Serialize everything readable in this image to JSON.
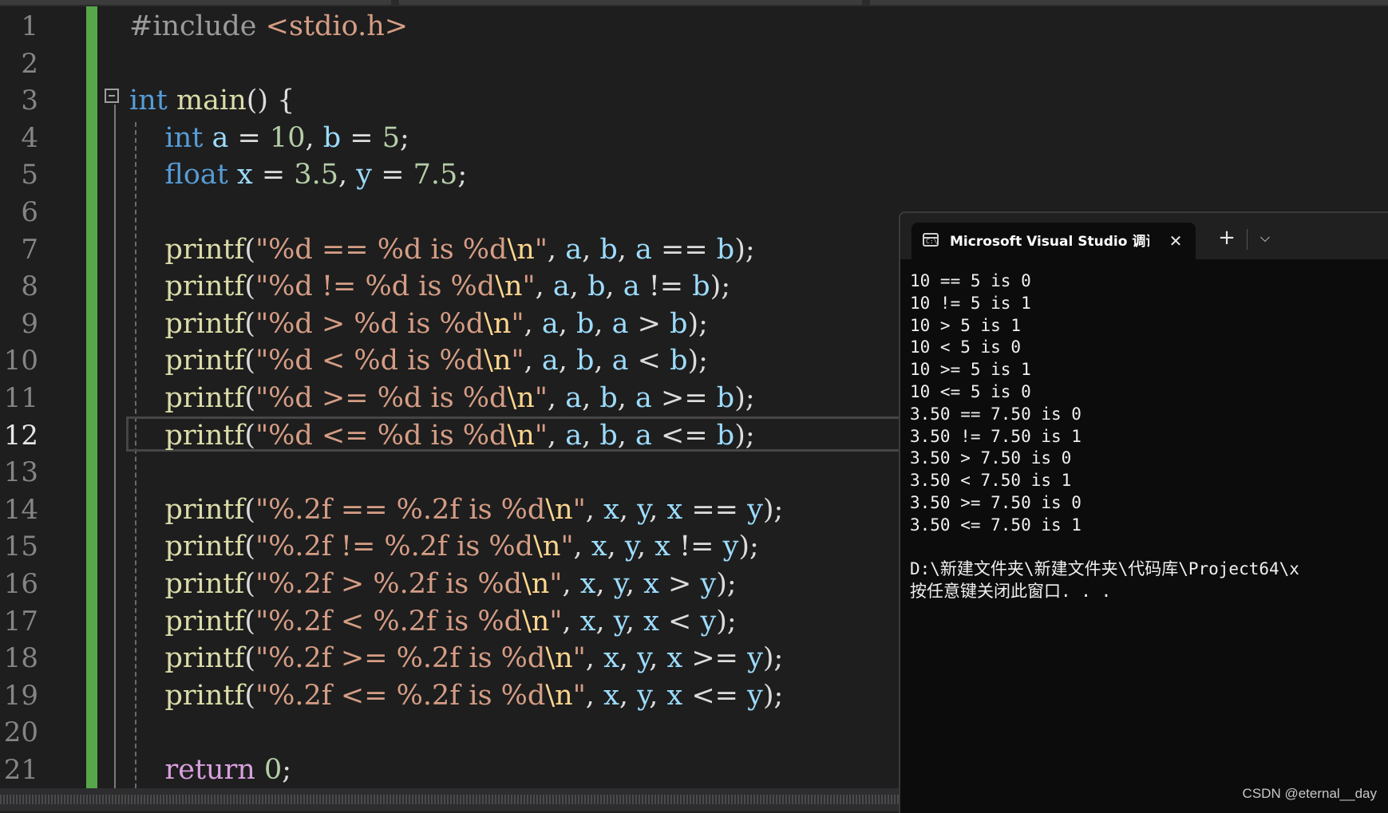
{
  "editor": {
    "line_numbers": [
      "1",
      "2",
      "3",
      "4",
      "5",
      "6",
      "7",
      "8",
      "9",
      "10",
      "11",
      "12",
      "13",
      "14",
      "15",
      "16",
      "17",
      "18",
      "19",
      "20",
      "21"
    ],
    "active_line": "12",
    "lines": [
      {
        "tokens": [
          {
            "t": "#include ",
            "c": "pp"
          },
          {
            "t": "<stdio.h>",
            "c": "str"
          }
        ]
      },
      {
        "tokens": []
      },
      {
        "tokens": [
          {
            "t": "int",
            "c": "kw"
          },
          {
            "t": " ",
            "c": ""
          },
          {
            "t": "main",
            "c": "fn"
          },
          {
            "t": "() {",
            "c": ""
          }
        ]
      },
      {
        "tokens": [
          {
            "t": "    ",
            "c": ""
          },
          {
            "t": "int",
            "c": "kw"
          },
          {
            "t": " ",
            "c": ""
          },
          {
            "t": "a",
            "c": "id"
          },
          {
            "t": " = ",
            "c": ""
          },
          {
            "t": "10",
            "c": "num"
          },
          {
            "t": ", ",
            "c": ""
          },
          {
            "t": "b",
            "c": "id"
          },
          {
            "t": " = ",
            "c": ""
          },
          {
            "t": "5",
            "c": "num"
          },
          {
            "t": ";",
            "c": ""
          }
        ]
      },
      {
        "tokens": [
          {
            "t": "    ",
            "c": ""
          },
          {
            "t": "float",
            "c": "kw"
          },
          {
            "t": " ",
            "c": ""
          },
          {
            "t": "x",
            "c": "id"
          },
          {
            "t": " = ",
            "c": ""
          },
          {
            "t": "3.5",
            "c": "num"
          },
          {
            "t": ", ",
            "c": ""
          },
          {
            "t": "y",
            "c": "id"
          },
          {
            "t": " = ",
            "c": ""
          },
          {
            "t": "7.5",
            "c": "num"
          },
          {
            "t": ";",
            "c": ""
          }
        ]
      },
      {
        "tokens": []
      },
      {
        "tokens": [
          {
            "t": "    ",
            "c": ""
          },
          {
            "t": "printf",
            "c": "fn"
          },
          {
            "t": "(",
            "c": ""
          },
          {
            "t": "\"%d == %d is %d",
            "c": "str"
          },
          {
            "t": "\\n",
            "c": "esc"
          },
          {
            "t": "\"",
            "c": "str"
          },
          {
            "t": ", ",
            "c": ""
          },
          {
            "t": "a",
            "c": "id"
          },
          {
            "t": ", ",
            "c": ""
          },
          {
            "t": "b",
            "c": "id"
          },
          {
            "t": ", ",
            "c": ""
          },
          {
            "t": "a",
            "c": "id"
          },
          {
            "t": " == ",
            "c": ""
          },
          {
            "t": "b",
            "c": "id"
          },
          {
            "t": ");",
            "c": ""
          }
        ]
      },
      {
        "tokens": [
          {
            "t": "    ",
            "c": ""
          },
          {
            "t": "printf",
            "c": "fn"
          },
          {
            "t": "(",
            "c": ""
          },
          {
            "t": "\"%d != %d is %d",
            "c": "str"
          },
          {
            "t": "\\n",
            "c": "esc"
          },
          {
            "t": "\"",
            "c": "str"
          },
          {
            "t": ", ",
            "c": ""
          },
          {
            "t": "a",
            "c": "id"
          },
          {
            "t": ", ",
            "c": ""
          },
          {
            "t": "b",
            "c": "id"
          },
          {
            "t": ", ",
            "c": ""
          },
          {
            "t": "a",
            "c": "id"
          },
          {
            "t": " != ",
            "c": ""
          },
          {
            "t": "b",
            "c": "id"
          },
          {
            "t": ");",
            "c": ""
          }
        ]
      },
      {
        "tokens": [
          {
            "t": "    ",
            "c": ""
          },
          {
            "t": "printf",
            "c": "fn"
          },
          {
            "t": "(",
            "c": ""
          },
          {
            "t": "\"%d > %d is %d",
            "c": "str"
          },
          {
            "t": "\\n",
            "c": "esc"
          },
          {
            "t": "\"",
            "c": "str"
          },
          {
            "t": ", ",
            "c": ""
          },
          {
            "t": "a",
            "c": "id"
          },
          {
            "t": ", ",
            "c": ""
          },
          {
            "t": "b",
            "c": "id"
          },
          {
            "t": ", ",
            "c": ""
          },
          {
            "t": "a",
            "c": "id"
          },
          {
            "t": " > ",
            "c": ""
          },
          {
            "t": "b",
            "c": "id"
          },
          {
            "t": ");",
            "c": ""
          }
        ]
      },
      {
        "tokens": [
          {
            "t": "    ",
            "c": ""
          },
          {
            "t": "printf",
            "c": "fn"
          },
          {
            "t": "(",
            "c": ""
          },
          {
            "t": "\"%d < %d is %d",
            "c": "str"
          },
          {
            "t": "\\n",
            "c": "esc"
          },
          {
            "t": "\"",
            "c": "str"
          },
          {
            "t": ", ",
            "c": ""
          },
          {
            "t": "a",
            "c": "id"
          },
          {
            "t": ", ",
            "c": ""
          },
          {
            "t": "b",
            "c": "id"
          },
          {
            "t": ", ",
            "c": ""
          },
          {
            "t": "a",
            "c": "id"
          },
          {
            "t": " < ",
            "c": ""
          },
          {
            "t": "b",
            "c": "id"
          },
          {
            "t": ");",
            "c": ""
          }
        ]
      },
      {
        "tokens": [
          {
            "t": "    ",
            "c": ""
          },
          {
            "t": "printf",
            "c": "fn"
          },
          {
            "t": "(",
            "c": ""
          },
          {
            "t": "\"%d >= %d is %d",
            "c": "str"
          },
          {
            "t": "\\n",
            "c": "esc"
          },
          {
            "t": "\"",
            "c": "str"
          },
          {
            "t": ", ",
            "c": ""
          },
          {
            "t": "a",
            "c": "id"
          },
          {
            "t": ", ",
            "c": ""
          },
          {
            "t": "b",
            "c": "id"
          },
          {
            "t": ", ",
            "c": ""
          },
          {
            "t": "a",
            "c": "id"
          },
          {
            "t": " >= ",
            "c": ""
          },
          {
            "t": "b",
            "c": "id"
          },
          {
            "t": ");",
            "c": ""
          }
        ]
      },
      {
        "tokens": [
          {
            "t": "    ",
            "c": ""
          },
          {
            "t": "printf",
            "c": "fn"
          },
          {
            "t": "(",
            "c": ""
          },
          {
            "t": "\"%d <= %d is %d",
            "c": "str"
          },
          {
            "t": "\\n",
            "c": "esc"
          },
          {
            "t": "\"",
            "c": "str"
          },
          {
            "t": ", ",
            "c": ""
          },
          {
            "t": "a",
            "c": "id"
          },
          {
            "t": ", ",
            "c": ""
          },
          {
            "t": "b",
            "c": "id"
          },
          {
            "t": ", ",
            "c": ""
          },
          {
            "t": "a",
            "c": "id"
          },
          {
            "t": " <= ",
            "c": ""
          },
          {
            "t": "b",
            "c": "id"
          },
          {
            "t": ");",
            "c": ""
          }
        ]
      },
      {
        "tokens": []
      },
      {
        "tokens": [
          {
            "t": "    ",
            "c": ""
          },
          {
            "t": "printf",
            "c": "fn"
          },
          {
            "t": "(",
            "c": ""
          },
          {
            "t": "\"%.2f == %.2f is %d",
            "c": "str"
          },
          {
            "t": "\\n",
            "c": "esc"
          },
          {
            "t": "\"",
            "c": "str"
          },
          {
            "t": ", ",
            "c": ""
          },
          {
            "t": "x",
            "c": "id"
          },
          {
            "t": ", ",
            "c": ""
          },
          {
            "t": "y",
            "c": "id"
          },
          {
            "t": ", ",
            "c": ""
          },
          {
            "t": "x",
            "c": "id"
          },
          {
            "t": " == ",
            "c": ""
          },
          {
            "t": "y",
            "c": "id"
          },
          {
            "t": ");",
            "c": ""
          }
        ]
      },
      {
        "tokens": [
          {
            "t": "    ",
            "c": ""
          },
          {
            "t": "printf",
            "c": "fn"
          },
          {
            "t": "(",
            "c": ""
          },
          {
            "t": "\"%.2f != %.2f is %d",
            "c": "str"
          },
          {
            "t": "\\n",
            "c": "esc"
          },
          {
            "t": "\"",
            "c": "str"
          },
          {
            "t": ", ",
            "c": ""
          },
          {
            "t": "x",
            "c": "id"
          },
          {
            "t": ", ",
            "c": ""
          },
          {
            "t": "y",
            "c": "id"
          },
          {
            "t": ", ",
            "c": ""
          },
          {
            "t": "x",
            "c": "id"
          },
          {
            "t": " != ",
            "c": ""
          },
          {
            "t": "y",
            "c": "id"
          },
          {
            "t": ");",
            "c": ""
          }
        ]
      },
      {
        "tokens": [
          {
            "t": "    ",
            "c": ""
          },
          {
            "t": "printf",
            "c": "fn"
          },
          {
            "t": "(",
            "c": ""
          },
          {
            "t": "\"%.2f > %.2f is %d",
            "c": "str"
          },
          {
            "t": "\\n",
            "c": "esc"
          },
          {
            "t": "\"",
            "c": "str"
          },
          {
            "t": ", ",
            "c": ""
          },
          {
            "t": "x",
            "c": "id"
          },
          {
            "t": ", ",
            "c": ""
          },
          {
            "t": "y",
            "c": "id"
          },
          {
            "t": ", ",
            "c": ""
          },
          {
            "t": "x",
            "c": "id"
          },
          {
            "t": " > ",
            "c": ""
          },
          {
            "t": "y",
            "c": "id"
          },
          {
            "t": ");",
            "c": ""
          }
        ]
      },
      {
        "tokens": [
          {
            "t": "    ",
            "c": ""
          },
          {
            "t": "printf",
            "c": "fn"
          },
          {
            "t": "(",
            "c": ""
          },
          {
            "t": "\"%.2f < %.2f is %d",
            "c": "str"
          },
          {
            "t": "\\n",
            "c": "esc"
          },
          {
            "t": "\"",
            "c": "str"
          },
          {
            "t": ", ",
            "c": ""
          },
          {
            "t": "x",
            "c": "id"
          },
          {
            "t": ", ",
            "c": ""
          },
          {
            "t": "y",
            "c": "id"
          },
          {
            "t": ", ",
            "c": ""
          },
          {
            "t": "x",
            "c": "id"
          },
          {
            "t": " < ",
            "c": ""
          },
          {
            "t": "y",
            "c": "id"
          },
          {
            "t": ");",
            "c": ""
          }
        ]
      },
      {
        "tokens": [
          {
            "t": "    ",
            "c": ""
          },
          {
            "t": "printf",
            "c": "fn"
          },
          {
            "t": "(",
            "c": ""
          },
          {
            "t": "\"%.2f >= %.2f is %d",
            "c": "str"
          },
          {
            "t": "\\n",
            "c": "esc"
          },
          {
            "t": "\"",
            "c": "str"
          },
          {
            "t": ", ",
            "c": ""
          },
          {
            "t": "x",
            "c": "id"
          },
          {
            "t": ", ",
            "c": ""
          },
          {
            "t": "y",
            "c": "id"
          },
          {
            "t": ", ",
            "c": ""
          },
          {
            "t": "x",
            "c": "id"
          },
          {
            "t": " >= ",
            "c": ""
          },
          {
            "t": "y",
            "c": "id"
          },
          {
            "t": ");",
            "c": ""
          }
        ]
      },
      {
        "tokens": [
          {
            "t": "    ",
            "c": ""
          },
          {
            "t": "printf",
            "c": "fn"
          },
          {
            "t": "(",
            "c": ""
          },
          {
            "t": "\"%.2f <= %.2f is %d",
            "c": "str"
          },
          {
            "t": "\\n",
            "c": "esc"
          },
          {
            "t": "\"",
            "c": "str"
          },
          {
            "t": ", ",
            "c": ""
          },
          {
            "t": "x",
            "c": "id"
          },
          {
            "t": ", ",
            "c": ""
          },
          {
            "t": "y",
            "c": "id"
          },
          {
            "t": ", ",
            "c": ""
          },
          {
            "t": "x",
            "c": "id"
          },
          {
            "t": " <= ",
            "c": ""
          },
          {
            "t": "y",
            "c": "id"
          },
          {
            "t": ");",
            "c": ""
          }
        ]
      },
      {
        "tokens": []
      },
      {
        "tokens": [
          {
            "t": "    ",
            "c": ""
          },
          {
            "t": "return",
            "c": "kw2"
          },
          {
            "t": " ",
            "c": ""
          },
          {
            "t": "0",
            "c": "num"
          },
          {
            "t": ";",
            "c": ""
          }
        ]
      }
    ]
  },
  "console": {
    "tab_title": "Microsoft Visual Studio 调试控",
    "tab_icon": "terminal-icon",
    "close_icon": "close-icon",
    "new_tab_label": "+",
    "dropdown_label": "⌵",
    "output_lines": [
      "10 == 5 is 0",
      "10 != 5 is 1",
      "10 > 5 is 1",
      "10 < 5 is 0",
      "10 >= 5 is 1",
      "10 <= 5 is 0",
      "3.50 == 7.50 is 0",
      "3.50 != 7.50 is 1",
      "3.50 > 7.50 is 0",
      "3.50 < 7.50 is 1",
      "3.50 >= 7.50 is 0",
      "3.50 <= 7.50 is 1",
      "",
      "D:\\新建文件夹\\新建文件夹\\代码库\\Project64\\x",
      "按任意键关闭此窗口. . ."
    ]
  },
  "watermark": "CSDN @eternal__day",
  "colors": {
    "editor_bg": "#1e1e1e",
    "console_bg": "#0c0c0c",
    "change_bar": "#57a64a",
    "keyword": "#569cd6",
    "string": "#d69d85",
    "number": "#b5cea8",
    "identifier": "#9cdcfe",
    "function": "#dcdcaa"
  }
}
